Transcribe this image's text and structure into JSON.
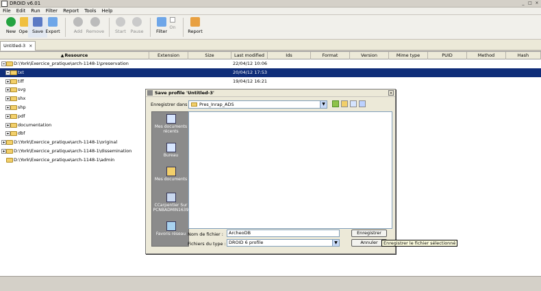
{
  "window": {
    "title": "DROID v6.01",
    "buttons": [
      "_",
      "□",
      "×"
    ]
  },
  "menu": [
    "File",
    "Edit",
    "Run",
    "Filter",
    "Report",
    "Tools",
    "Help"
  ],
  "toolbar": {
    "new": "New",
    "open": "Open",
    "save": "Save",
    "export": "Export",
    "add": "Add",
    "remove": "Remove",
    "start": "Start",
    "pause": "Pause",
    "filter": "Filter",
    "on": "On",
    "report": "Report"
  },
  "tab": {
    "label": "Untitled-3",
    "close": "×"
  },
  "table": {
    "columns": [
      {
        "key": "resource",
        "label": "Resource",
        "sorted": true
      },
      {
        "key": "extension",
        "label": "Extension"
      },
      {
        "key": "size",
        "label": "Size"
      },
      {
        "key": "last_modified",
        "label": "Last modified"
      },
      {
        "key": "ids",
        "label": "Ids"
      },
      {
        "key": "format",
        "label": "Format"
      },
      {
        "key": "version",
        "label": "Version"
      },
      {
        "key": "mime_type",
        "label": "Mime type"
      },
      {
        "key": "puid",
        "label": "PUID"
      },
      {
        "key": "method",
        "label": "Method"
      },
      {
        "key": "hash",
        "label": "Hash"
      }
    ],
    "rows": [
      {
        "name": "D:\\York\\Exercice_pratique\\arch-1148-1\\preservation",
        "last_modified": "22/04/12 10:06",
        "level": 0,
        "expanded": true,
        "selected": false
      },
      {
        "name": "txt",
        "last_modified": "20/04/12 17:53",
        "level": 1,
        "expanded": true,
        "selected": true
      },
      {
        "name": "tiff",
        "last_modified": "19/04/12 16:21",
        "level": 1,
        "expanded": false,
        "selected": false
      },
      {
        "name": "svg",
        "last_modified": "",
        "level": 1,
        "expanded": false,
        "selected": false
      },
      {
        "name": "shx",
        "last_modified": "",
        "level": 1,
        "expanded": false,
        "selected": false
      },
      {
        "name": "shp",
        "last_modified": "",
        "level": 1,
        "expanded": false,
        "selected": false
      },
      {
        "name": "pdf",
        "last_modified": "",
        "level": 1,
        "expanded": false,
        "selected": false
      },
      {
        "name": "documentation",
        "last_modified": "",
        "level": 1,
        "expanded": false,
        "selected": false
      },
      {
        "name": "dbf",
        "last_modified": "",
        "level": 1,
        "expanded": false,
        "selected": false
      },
      {
        "name": "D:\\York\\Exercice_pratique\\arch-1148-1\\original",
        "last_modified": "",
        "level": 0,
        "expanded": false,
        "selected": false
      },
      {
        "name": "D:\\York\\Exercice_pratique\\arch-1148-1\\dissemination",
        "last_modified": "",
        "level": 0,
        "expanded": false,
        "selected": false
      },
      {
        "name": "D:\\York\\Exercice_pratique\\arch-1148-1\\admin",
        "last_modified": "",
        "level": 0,
        "expanded": false,
        "selected": false,
        "no_toggle": true
      }
    ]
  },
  "dialog": {
    "title": "Save profile 'Untitled-3'",
    "look_in_label": "Enregistrer dans :",
    "look_in_value": "Pres_Inrap_ADS",
    "places": [
      {
        "label": "Mes documents récents",
        "icon": "recent-docs-icon"
      },
      {
        "label": "Bureau",
        "icon": "desktop-icon"
      },
      {
        "label": "Mes documents",
        "icon": "my-documents-icon"
      },
      {
        "label": "CCarpentier Sur PCNBADMIN1639",
        "icon": "computer-icon"
      },
      {
        "label": "Favoris réseau",
        "icon": "network-icon"
      }
    ],
    "filename_label": "Nom de fichier :",
    "filename_value": "ArcheoDB",
    "filetype_label": "Fichiers du type :",
    "filetype_value": "DROID 6 profile",
    "save_button": "Enregistrer",
    "cancel_button": "Annuler",
    "close": "×"
  },
  "tooltip": "Enregistrer le fichier sélectionné"
}
